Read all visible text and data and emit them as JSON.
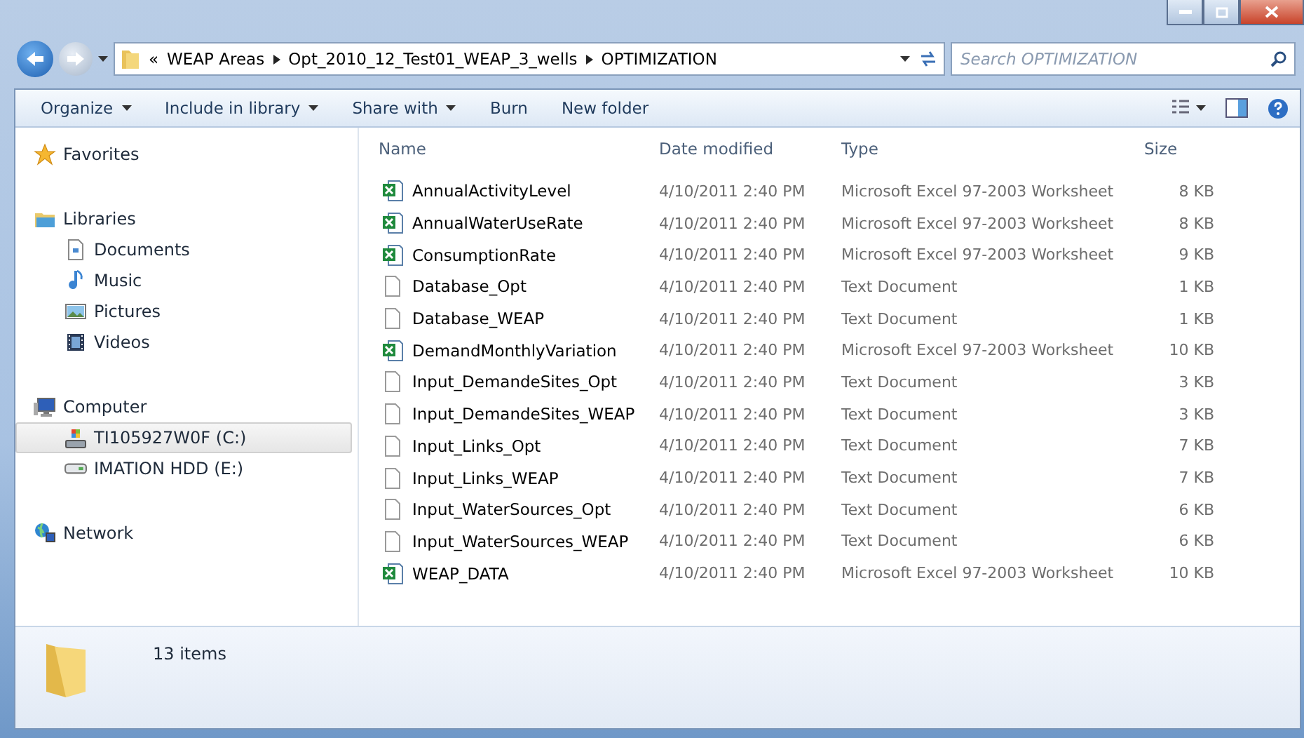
{
  "address": {
    "overflow": "«",
    "crumbs": [
      "WEAP Areas",
      "Opt_2010_12_Test01_WEAP_3_wells",
      "OPTIMIZATION"
    ]
  },
  "search": {
    "placeholder": "Search OPTIMIZATION"
  },
  "toolbar": [
    {
      "label": "Organize",
      "dropdown": true
    },
    {
      "label": "Include in library",
      "dropdown": true
    },
    {
      "label": "Share with",
      "dropdown": true
    },
    {
      "label": "Burn",
      "dropdown": false
    },
    {
      "label": "New folder",
      "dropdown": false
    }
  ],
  "sidebar": [
    {
      "label": "Favorites",
      "kind": "star",
      "selected": false
    },
    {
      "label": "Libraries",
      "kind": "library",
      "selected": false,
      "children": [
        {
          "label": "Documents",
          "kind": "document",
          "selected": false
        },
        {
          "label": "Music",
          "kind": "music",
          "selected": false
        },
        {
          "label": "Pictures",
          "kind": "pictures",
          "selected": false
        },
        {
          "label": "Videos",
          "kind": "video",
          "selected": false
        }
      ]
    },
    {
      "label": "Computer",
      "kind": "computer",
      "selected": false,
      "children": [
        {
          "label": "TI105927W0F (C:)",
          "kind": "system-drive",
          "selected": true
        },
        {
          "label": "IMATION HDD (E:)",
          "kind": "drive",
          "selected": false
        }
      ]
    },
    {
      "label": "Network",
      "kind": "network",
      "selected": false
    }
  ],
  "table": {
    "columns": [
      "Name",
      "Date modified",
      "Type",
      "Size"
    ],
    "rows": [
      {
        "kind": "excel",
        "name": "AnnualActivityLevel",
        "date": "4/10/2011 2:40 PM",
        "type": "Microsoft Excel 97-2003 Worksheet",
        "size": "8 KB"
      },
      {
        "kind": "excel",
        "name": "AnnualWaterUseRate",
        "date": "4/10/2011 2:40 PM",
        "type": "Microsoft Excel 97-2003 Worksheet",
        "size": "8 KB"
      },
      {
        "kind": "excel",
        "name": "ConsumptionRate",
        "date": "4/10/2011 2:40 PM",
        "type": "Microsoft Excel 97-2003 Worksheet",
        "size": "9 KB"
      },
      {
        "kind": "text",
        "name": "Database_Opt",
        "date": "4/10/2011 2:40 PM",
        "type": "Text Document",
        "size": "1 KB"
      },
      {
        "kind": "text",
        "name": "Database_WEAP",
        "date": "4/10/2011 2:40 PM",
        "type": "Text Document",
        "size": "1 KB"
      },
      {
        "kind": "excel",
        "name": "DemandMonthlyVariation",
        "date": "4/10/2011 2:40 PM",
        "type": "Microsoft Excel 97-2003 Worksheet",
        "size": "10 KB"
      },
      {
        "kind": "text",
        "name": "Input_DemandeSites_Opt",
        "date": "4/10/2011 2:40 PM",
        "type": "Text Document",
        "size": "3 KB"
      },
      {
        "kind": "text",
        "name": "Input_DemandeSites_WEAP",
        "date": "4/10/2011 2:40 PM",
        "type": "Text Document",
        "size": "3 KB"
      },
      {
        "kind": "text",
        "name": "Input_Links_Opt",
        "date": "4/10/2011 2:40 PM",
        "type": "Text Document",
        "size": "7 KB"
      },
      {
        "kind": "text",
        "name": "Input_Links_WEAP",
        "date": "4/10/2011 2:40 PM",
        "type": "Text Document",
        "size": "7 KB"
      },
      {
        "kind": "text",
        "name": "Input_WaterSources_Opt",
        "date": "4/10/2011 2:40 PM",
        "type": "Text Document",
        "size": "6 KB"
      },
      {
        "kind": "text",
        "name": "Input_WaterSources_WEAP",
        "date": "4/10/2011 2:40 PM",
        "type": "Text Document",
        "size": "6 KB"
      },
      {
        "kind": "excel",
        "name": "WEAP_DATA",
        "date": "4/10/2011 2:40 PM",
        "type": "Microsoft Excel 97-2003 Worksheet",
        "size": "10 KB"
      }
    ]
  },
  "status_bar": {
    "count": "13 items"
  }
}
